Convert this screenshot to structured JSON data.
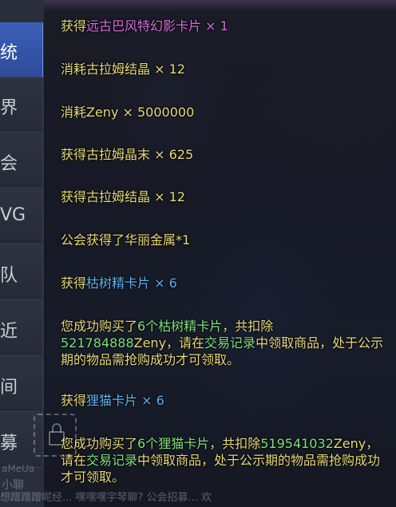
{
  "channels": [
    "统",
    "界",
    "会",
    "VG",
    "队",
    "近",
    "间",
    "募"
  ],
  "active_channel": 0,
  "messages": [
    {
      "parts": [
        {
          "t": "获得",
          "c": "gold"
        },
        {
          "t": "远古巴风特幻影卡片",
          "c": "purple"
        },
        {
          "t": " × 1",
          "c": "purple"
        }
      ]
    },
    {
      "parts": [
        {
          "t": "消耗古拉姆结晶",
          "c": "gold"
        },
        {
          "t": " × 12",
          "c": "gold"
        }
      ]
    },
    {
      "parts": [
        {
          "t": "消耗Zeny",
          "c": "gold"
        },
        {
          "t": " × 5000000",
          "c": "gold"
        }
      ]
    },
    {
      "parts": [
        {
          "t": "获得古拉姆晶末",
          "c": "gold"
        },
        {
          "t": " × 625",
          "c": "gold"
        }
      ]
    },
    {
      "parts": [
        {
          "t": "获得古拉姆结晶",
          "c": "gold"
        },
        {
          "t": " × 12",
          "c": "gold"
        }
      ]
    },
    {
      "parts": [
        {
          "t": "公会获得了华丽金属*1",
          "c": "gold"
        }
      ]
    },
    {
      "parts": [
        {
          "t": "获得",
          "c": "gold"
        },
        {
          "t": "枯树精卡片",
          "c": "blue"
        },
        {
          "t": " × 6",
          "c": "blue"
        }
      ]
    },
    {
      "parts": [
        {
          "t": "您成功购买了",
          "c": "yellow"
        },
        {
          "t": "6个枯树精卡片",
          "c": "green"
        },
        {
          "t": "，共扣除",
          "c": "yellow"
        },
        {
          "t": "521784888",
          "c": "green"
        },
        {
          "t": "Zeny，请在",
          "c": "yellow"
        },
        {
          "t": "交易记录",
          "c": "green"
        },
        {
          "t": "中领取商品，处于公示期的物品需抢购成功才可领取。",
          "c": "yellow"
        }
      ]
    },
    {
      "parts": [
        {
          "t": "获得",
          "c": "gold"
        },
        {
          "t": "狸猫卡片",
          "c": "blue"
        },
        {
          "t": " × 6",
          "c": "blue"
        }
      ]
    },
    {
      "parts": [
        {
          "t": "您成功购买了",
          "c": "yellow"
        },
        {
          "t": "6个狸猫卡片",
          "c": "green"
        },
        {
          "t": "，共扣除",
          "c": "yellow"
        },
        {
          "t": "519541032",
          "c": "green"
        },
        {
          "t": "Zeny，请在",
          "c": "yellow"
        },
        {
          "t": "交易记录",
          "c": "green"
        },
        {
          "t": "中领取商品，处于公示期的物品需抢购成功才可领取。",
          "c": "yellow"
        }
      ]
    }
  ],
  "background_text": [
    "aMeUa",
    "小聊",
    "想蹭蹭蹭呢经... 嘿嘿嘿宇琴聊? 公会招募... 欢"
  ],
  "colors": {
    "gold": "#e8d977",
    "purple": "#d86ce0",
    "blue": "#5fb2ef",
    "green": "#7ee07a",
    "tab_active": "#3b5fb6"
  }
}
